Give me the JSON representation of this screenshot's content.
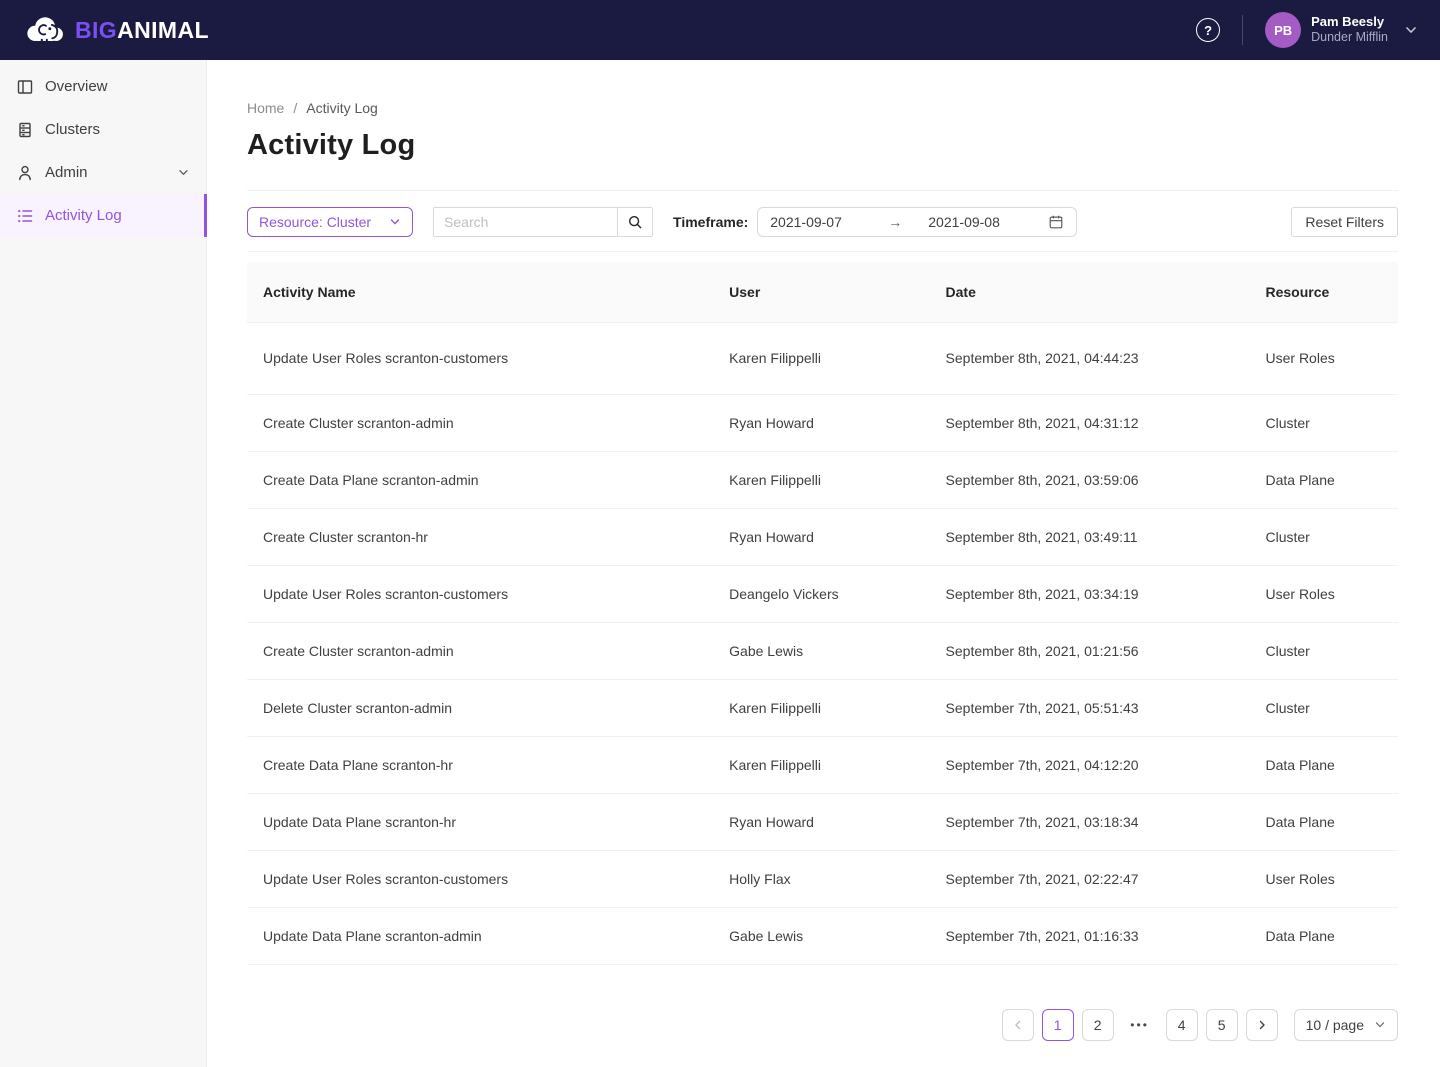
{
  "header": {
    "brand": {
      "big": "BIG",
      "animal": "ANIMAL"
    },
    "help_glyph": "?",
    "user": {
      "initials": "PB",
      "name": "Pam Beesly",
      "org": "Dunder Mifflin"
    }
  },
  "sidebar": {
    "items": [
      {
        "label": "Overview",
        "icon": "overview-icon",
        "active": false,
        "expandable": false
      },
      {
        "label": "Clusters",
        "icon": "clusters-icon",
        "active": false,
        "expandable": false
      },
      {
        "label": "Admin",
        "icon": "admin-icon",
        "active": false,
        "expandable": true
      },
      {
        "label": "Activity Log",
        "icon": "activity-log-icon",
        "active": true,
        "expandable": false
      }
    ]
  },
  "breadcrumb": {
    "home": "Home",
    "separator": "/",
    "current": "Activity Log"
  },
  "page": {
    "title": "Activity Log"
  },
  "filters": {
    "resource_select_value": "Resource: Cluster",
    "search_placeholder": "Search",
    "timeframe_label": "Timeframe:",
    "date_from": "2021-09-07",
    "range_arrow": "→",
    "date_to": "2021-09-08",
    "reset_label": "Reset Filters"
  },
  "table": {
    "columns": [
      "Activity Name",
      "User",
      "Date",
      "Resource"
    ],
    "rows": [
      {
        "activity": "Update User Roles scranton-customers",
        "user": "Karen Filippelli",
        "date": "September 8th, 2021, 04:44:23",
        "resource": "User Roles"
      },
      {
        "activity": "Create Cluster scranton-admin",
        "user": "Ryan Howard",
        "date": "September 8th, 2021, 04:31:12",
        "resource": "Cluster"
      },
      {
        "activity": "Create Data Plane scranton-admin",
        "user": "Karen Filippelli",
        "date": "September 8th, 2021, 03:59:06",
        "resource": "Data Plane"
      },
      {
        "activity": "Create Cluster scranton-hr",
        "user": "Ryan Howard",
        "date": "September 8th, 2021, 03:49:11",
        "resource": "Cluster"
      },
      {
        "activity": "Update User Roles scranton-customers",
        "user": "Deangelo Vickers",
        "date": "September 8th, 2021, 03:34:19",
        "resource": "User Roles"
      },
      {
        "activity": "Create Cluster scranton-admin",
        "user": "Gabe Lewis",
        "date": "September 8th, 2021, 01:21:56",
        "resource": "Cluster"
      },
      {
        "activity": "Delete Cluster scranton-admin",
        "user": "Karen Filippelli",
        "date": "September 7th, 2021, 05:51:43",
        "resource": "Cluster"
      },
      {
        "activity": "Create Data Plane scranton-hr",
        "user": "Karen Filippelli",
        "date": "September 7th, 2021, 04:12:20",
        "resource": "Data Plane"
      },
      {
        "activity": "Update Data Plane scranton-hr",
        "user": "Ryan Howard",
        "date": "September 7th, 2021, 03:18:34",
        "resource": "Data Plane"
      },
      {
        "activity": "Update User Roles scranton-customers",
        "user": "Holly Flax",
        "date": "September 7th, 2021, 02:22:47",
        "resource": "User Roles"
      },
      {
        "activity": "Update Data Plane scranton-admin",
        "user": "Gabe Lewis",
        "date": "September 7th, 2021, 01:16:33",
        "resource": "Data Plane"
      }
    ]
  },
  "pagination": {
    "pages": [
      {
        "label": "1",
        "active": true
      },
      {
        "label": "2",
        "active": false
      },
      {
        "label": "•••",
        "ellipsis": true
      },
      {
        "label": "4",
        "active": false
      },
      {
        "label": "5",
        "active": false
      }
    ],
    "page_size": "10 / page"
  },
  "colors": {
    "header-bg": "#1b1a41",
    "brand-purple": "#7b4ff2",
    "accent": "#9254de",
    "accent-bg": "#f8f3fe",
    "avatar-bg": "#a45cc5"
  }
}
